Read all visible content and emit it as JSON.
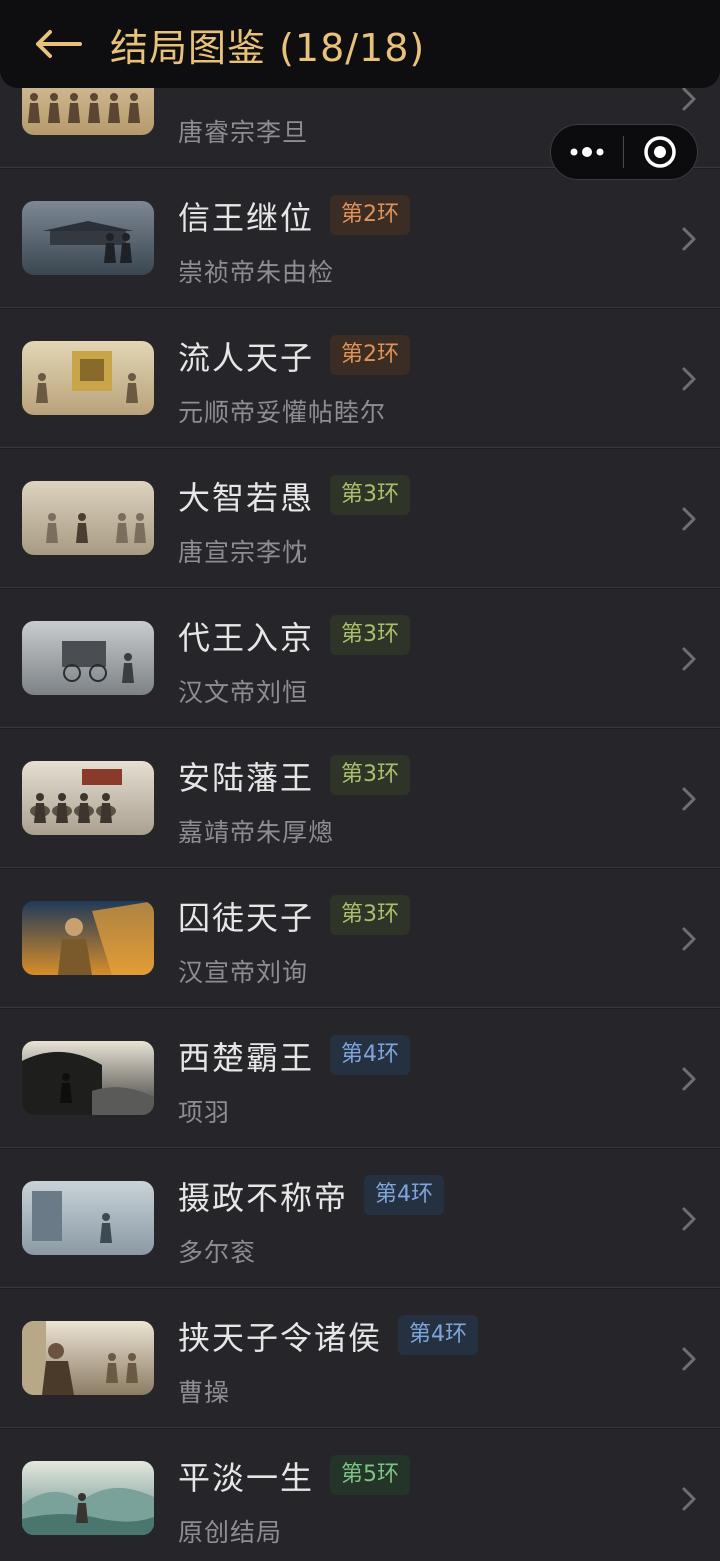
{
  "header": {
    "title": "结局图鉴 (18/18)",
    "back_icon": "arrow-left-icon",
    "title_color": "#e8c27a"
  },
  "capsule": {
    "more_icon": "more-dots-icon",
    "close_icon": "target-circle-icon"
  },
  "badge_colors": {
    "2": {
      "bg": "#3b2d24",
      "fg": "#e0935a"
    },
    "3": {
      "bg": "#2f3428",
      "fg": "#a9c06c"
    },
    "4": {
      "bg": "#253040",
      "fg": "#7ea6dc"
    },
    "5": {
      "bg": "#243428",
      "fg": "#7cc483"
    }
  },
  "items": [
    {
      "title": "",
      "badge": "",
      "tier": "2",
      "subtitle": "唐睿宗李旦",
      "thumb": "court"
    },
    {
      "title": "信王继位",
      "badge": "第2环",
      "tier": "2",
      "subtitle": "崇祯帝朱由检",
      "thumb": "palace-storm"
    },
    {
      "title": "流人天子",
      "badge": "第2环",
      "tier": "2",
      "subtitle": "元顺帝妥懽帖睦尔",
      "thumb": "throne"
    },
    {
      "title": "大智若愚",
      "badge": "第3环",
      "tier": "3",
      "subtitle": "唐宣宗李忱",
      "thumb": "dance"
    },
    {
      "title": "代王入京",
      "badge": "第3环",
      "tier": "3",
      "subtitle": "汉文帝刘恒",
      "thumb": "carriage"
    },
    {
      "title": "安陆藩王",
      "badge": "第3环",
      "tier": "3",
      "subtitle": "嘉靖帝朱厚熜",
      "thumb": "riders"
    },
    {
      "title": "囚徒天子",
      "badge": "第3环",
      "tier": "3",
      "subtitle": "汉宣帝刘询",
      "thumb": "prisoner"
    },
    {
      "title": "西楚霸王",
      "badge": "第4环",
      "tier": "4",
      "subtitle": "项羽",
      "thumb": "warrior"
    },
    {
      "title": "摄政不称帝",
      "badge": "第4环",
      "tier": "4",
      "subtitle": "多尔衮",
      "thumb": "regent"
    },
    {
      "title": "挟天子令诸侯",
      "badge": "第4环",
      "tier": "4",
      "subtitle": "曹操",
      "thumb": "caocao"
    },
    {
      "title": "平淡一生",
      "badge": "第5环",
      "tier": "5",
      "subtitle": "原创结局",
      "thumb": "landscape"
    }
  ]
}
